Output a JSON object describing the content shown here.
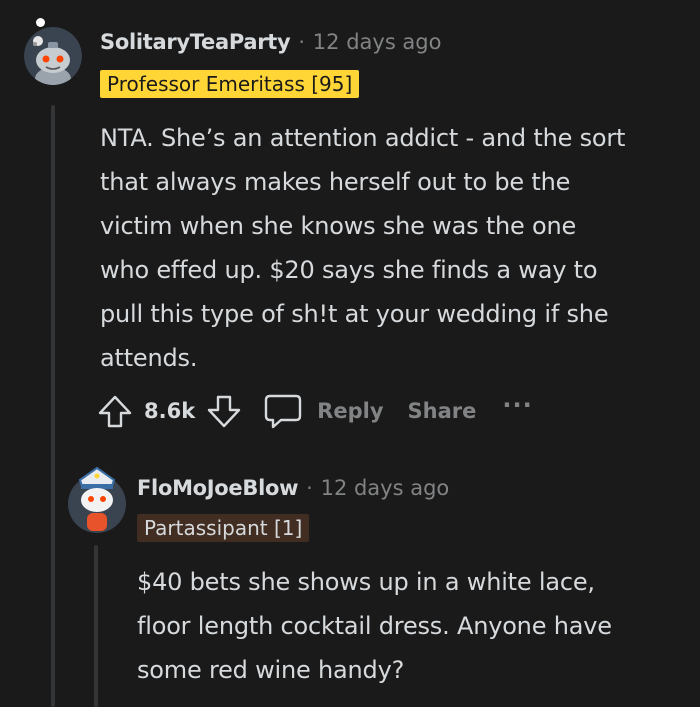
{
  "comment1": {
    "username": "SolitaryTeaParty",
    "separator": "·",
    "time": "12 days ago",
    "flair": "Professor Emeritass [95]",
    "body": [
      "NTA. She’s an attention addict - and the sort",
      "that always makes herself out to be the",
      "victim when she knows she was the one",
      "who effed up. $20 says she finds a way to",
      "pull this type of sh!t at your wedding if she",
      "attends."
    ],
    "votes": "8.6k",
    "reply_label": "Reply",
    "share_label": "Share",
    "more_label": "···"
  },
  "comment2": {
    "username": "FloMoJoeBlow",
    "separator": "·",
    "time": "12 days ago",
    "flair": "Partassipant [1]",
    "body": [
      "$40 bets she shows up in a white lace,",
      "floor length cocktail dress. Anyone have",
      "some red wine handy?"
    ]
  },
  "colors": {
    "background": "#1a1a1b",
    "flair_gold": "#ffd635",
    "flair_brown": "#412d21",
    "muted": "#818384"
  }
}
